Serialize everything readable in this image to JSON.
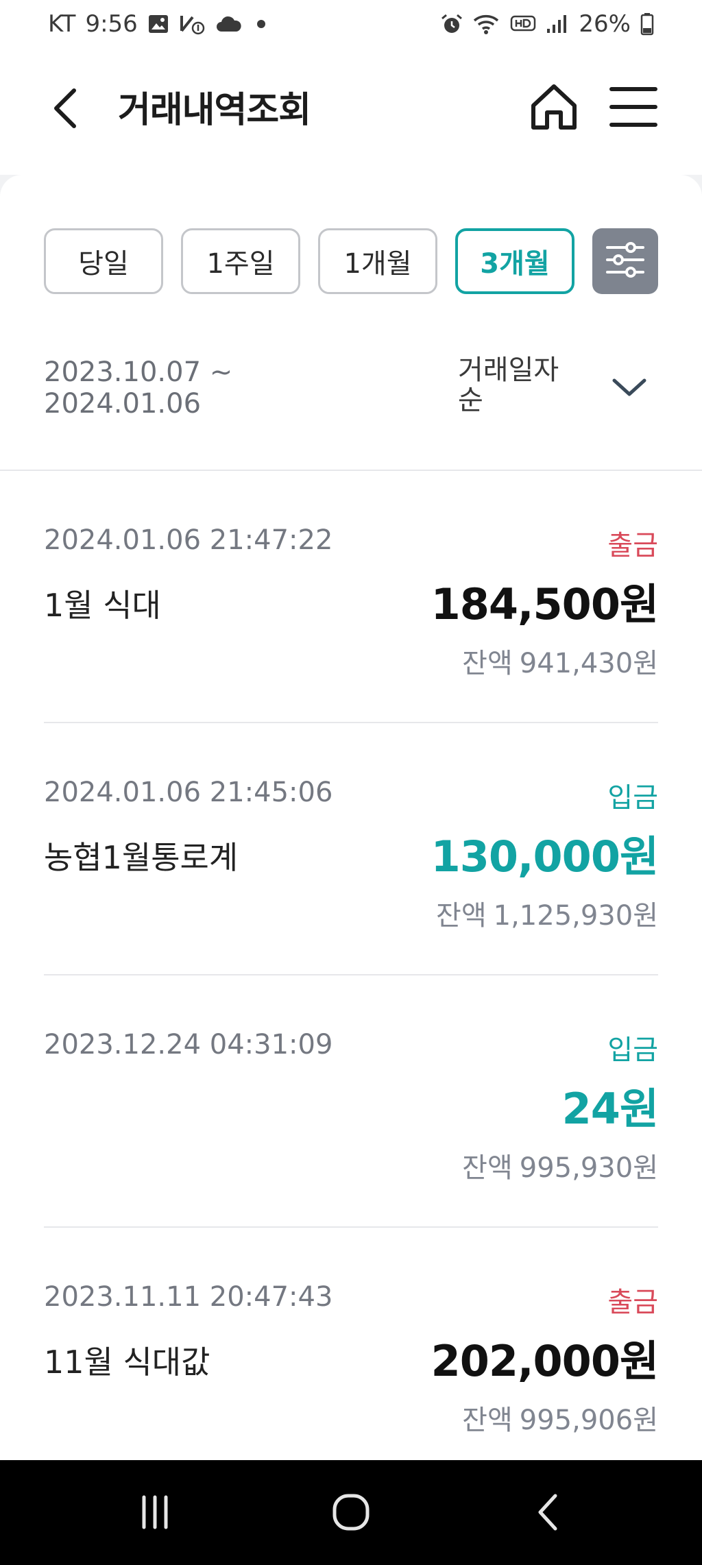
{
  "status_bar": {
    "carrier": "KT",
    "time": "9:56",
    "battery": "26%"
  },
  "header": {
    "title": "거래내역조회"
  },
  "filters": [
    {
      "label": "당일",
      "active": false
    },
    {
      "label": "1주일",
      "active": false
    },
    {
      "label": "1개월",
      "active": false
    },
    {
      "label": "3개월",
      "active": true
    }
  ],
  "period": {
    "start": "2023.10.07 ~",
    "end": "2024.01.06"
  },
  "sort": {
    "label": "거래일자순"
  },
  "transactions": [
    {
      "datetime": "2024.01.06 21:47:22",
      "type": "출금",
      "kind": "out",
      "description": "1월 식대",
      "amount": "184,500원",
      "balance_label": "잔액",
      "balance": "941,430원"
    },
    {
      "datetime": "2024.01.06 21:45:06",
      "type": "입금",
      "kind": "in",
      "description": "농협1월통로계",
      "amount": "130,000원",
      "balance_label": "잔액",
      "balance": "1,125,930원"
    },
    {
      "datetime": "2023.12.24 04:31:09",
      "type": "입금",
      "kind": "in",
      "description": "",
      "amount": "24원",
      "balance_label": "잔액",
      "balance": "995,930원"
    },
    {
      "datetime": "2023.11.11 20:47:43",
      "type": "출금",
      "kind": "out",
      "description": "11월 식대값",
      "amount": "202,000원",
      "balance_label": "잔액",
      "balance": "995,906원"
    }
  ],
  "colors": {
    "accent": "#12a3a3",
    "withdrawal": "#d94a5a",
    "filter_settings_bg": "#7e848f"
  },
  "icons": {
    "back": "chevron-left-icon",
    "home": "home-icon",
    "menu": "hamburger-menu-icon",
    "filter_settings": "sliders-icon",
    "sort": "chevron-down-icon"
  }
}
